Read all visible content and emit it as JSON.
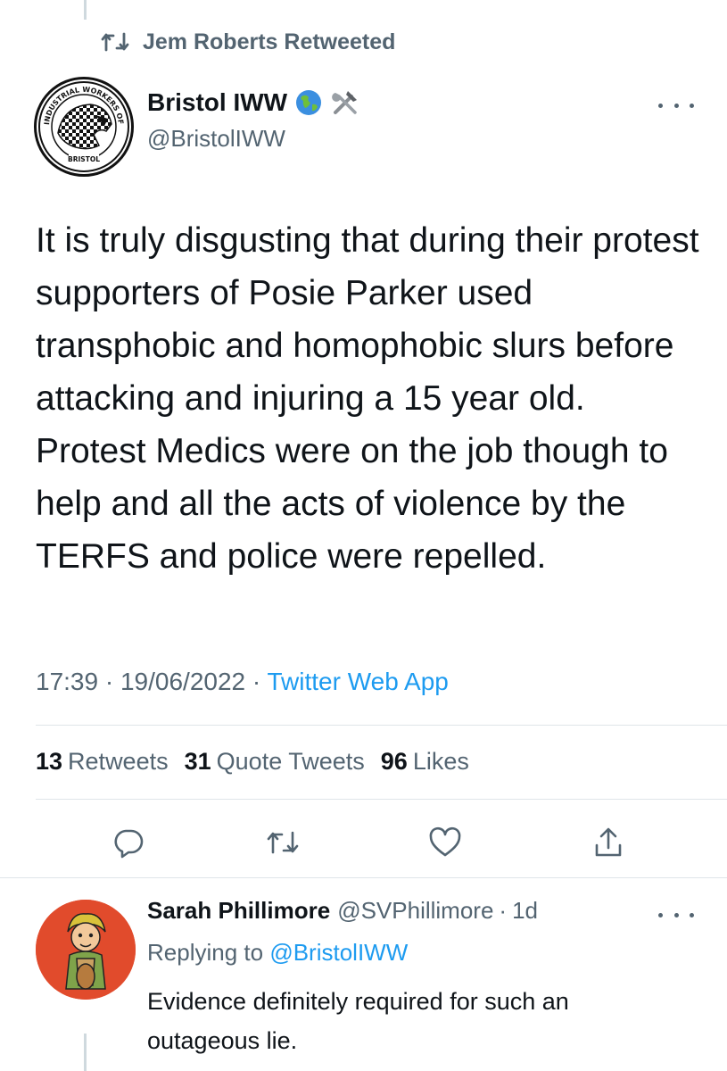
{
  "retweet_banner": {
    "text": "Jem Roberts Retweeted",
    "icon": "retweet-icon"
  },
  "tweet": {
    "author_name": "Bristol IWW",
    "author_emoji": [
      "globe-emoji",
      "hammer-wrench-emoji"
    ],
    "author_handle": "@BristolIWW",
    "avatar_logo_text_top": "INDUSTRIAL WORKERS OF THE WORLD",
    "avatar_logo_text_bottom": "BRISTOL",
    "text": "It is truly disgusting that during their protest supporters of Posie Parker used transphobic and homophobic slurs before attacking and injuring a 15 year old. Protest Medics were on the job though to help and all the acts of violence by the TERFS and police were repelled.",
    "time": "17:39",
    "date": "19/06/2022",
    "separator": "·",
    "source": "Twitter Web App",
    "stats": {
      "retweets_count": "13",
      "retweets_label": "Retweets",
      "quotes_count": "31",
      "quotes_label": "Quote Tweets",
      "likes_count": "96",
      "likes_label": "Likes"
    },
    "actions": [
      "reply-icon",
      "retweet-icon",
      "like-icon",
      "share-icon"
    ]
  },
  "reply": {
    "author_name": "Sarah Phillimore",
    "author_handle": "@SVPhillimore",
    "separator": "·",
    "age": "1d",
    "replying_prefix": "Replying to",
    "replying_mention": "@BristolIWW",
    "text": "Evidence definitely required for such an outageous lie."
  },
  "colors": {
    "text_primary": "#0f1419",
    "text_secondary": "#536471",
    "link": "#1d9bf0",
    "divider": "#dfe5e9",
    "reply_avatar_bg": "#e14b2c"
  }
}
